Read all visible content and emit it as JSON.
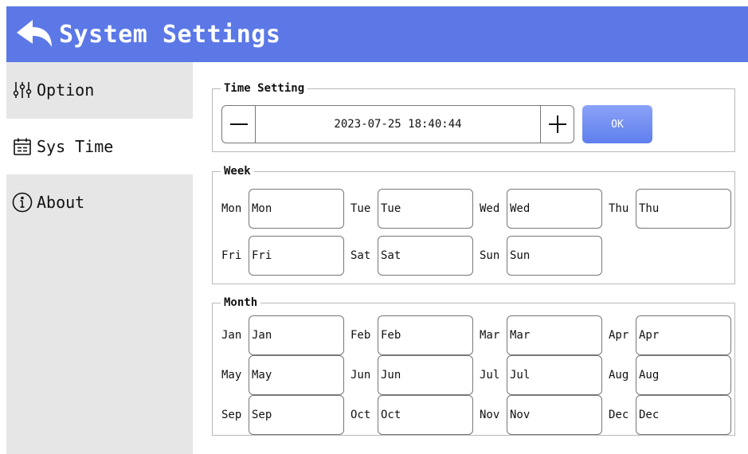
{
  "header": {
    "title": "System Settings",
    "back_icon": "back-arrow-icon"
  },
  "sidebar": {
    "items": [
      {
        "label": "Option",
        "icon": "sliders-icon",
        "active": false
      },
      {
        "label": "Sys Time",
        "icon": "calendar-icon",
        "active": true
      },
      {
        "label": "About",
        "icon": "info-icon",
        "active": false
      }
    ]
  },
  "time_setting": {
    "title": "Time Setting",
    "value": "2023-07-25 18:40:44",
    "ok_label": "OK",
    "ok_color": "#6f8cf2"
  },
  "week": {
    "title": "Week",
    "items": [
      {
        "label": "Mon",
        "value": "Mon"
      },
      {
        "label": "Tue",
        "value": "Tue"
      },
      {
        "label": "Wed",
        "value": "Wed"
      },
      {
        "label": "Thu",
        "value": "Thu"
      },
      {
        "label": "Fri",
        "value": "Fri"
      },
      {
        "label": "Sat",
        "value": "Sat"
      },
      {
        "label": "Sun",
        "value": "Sun"
      }
    ]
  },
  "month": {
    "title": "Month",
    "items": [
      {
        "label": "Jan",
        "value": "Jan"
      },
      {
        "label": "Feb",
        "value": "Feb"
      },
      {
        "label": "Mar",
        "value": "Mar"
      },
      {
        "label": "Apr",
        "value": "Apr"
      },
      {
        "label": "May",
        "value": "May"
      },
      {
        "label": "Jun",
        "value": "Jun"
      },
      {
        "label": "Jul",
        "value": "Jul"
      },
      {
        "label": "Aug",
        "value": "Aug"
      },
      {
        "label": "Sep",
        "value": "Sep"
      },
      {
        "label": "Oct",
        "value": "Oct"
      },
      {
        "label": "Nov",
        "value": "Nov"
      },
      {
        "label": "Dec",
        "value": "Dec"
      }
    ]
  },
  "colors": {
    "header_bg": "#5b78e6",
    "sidebar_bg": "#e6e6e6",
    "border": "#b9b9b9"
  }
}
